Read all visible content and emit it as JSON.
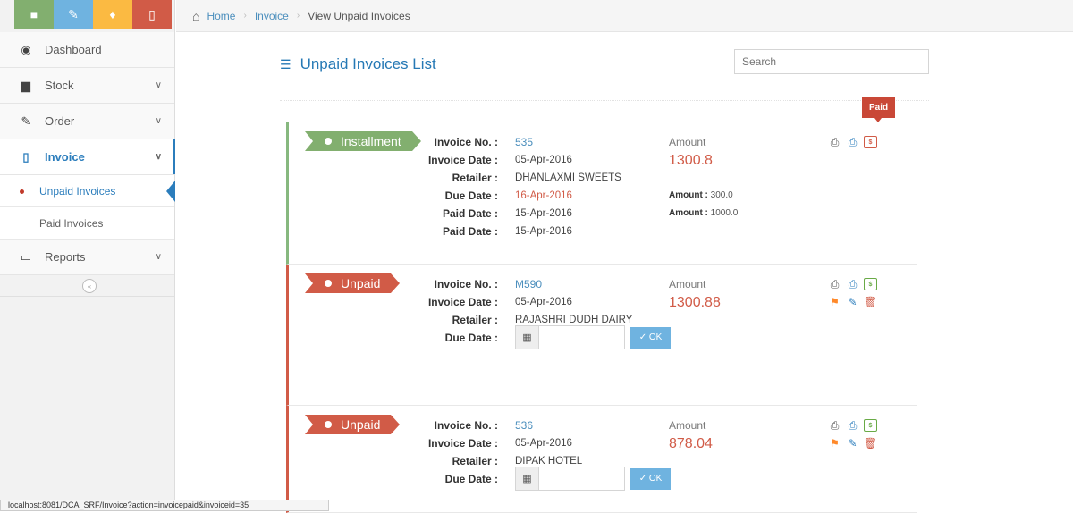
{
  "sidebar": {
    "shortcut_colors": [
      "#82af6f",
      "#6fb3e0",
      "#fbba42",
      "#d15b47"
    ],
    "items": [
      {
        "label": "Dashboard",
        "icon": "dashboard-icon"
      },
      {
        "label": "Stock",
        "icon": "briefcase-icon"
      },
      {
        "label": "Order",
        "icon": "edit-icon"
      },
      {
        "label": "Invoice",
        "icon": "file-icon"
      },
      {
        "label": "Reports",
        "icon": "desktop-icon"
      }
    ],
    "submenu": [
      {
        "label": "Unpaid Invoices"
      },
      {
        "label": "Paid Invoices"
      }
    ]
  },
  "breadcrumb": {
    "home": "Home",
    "invoice": "Invoice",
    "current": "View Unpaid Invoices"
  },
  "page": {
    "title": "Unpaid Invoices List",
    "search_placeholder": "Search"
  },
  "field_labels": {
    "invoice_no": "Invoice No. :",
    "invoice_date": "Invoice Date :",
    "retailer": "Retailer :",
    "due_date": "Due Date :",
    "paid_date": "Paid Date :",
    "amount": "Amount",
    "installment_amount": "Amount :"
  },
  "tooltip": "Paid",
  "ok_label": "OK",
  "invoices": [
    {
      "status": "Installment",
      "invoice_no": "535",
      "invoice_date": "05-Apr-2016",
      "retailer": "DHANLAXMI SWEETS",
      "due_date": "16-Apr-2016",
      "paid_dates": [
        "15-Apr-2016",
        "15-Apr-2016"
      ],
      "amount": "1300.8",
      "installments": [
        "300.0",
        "1000.0"
      ]
    },
    {
      "status": "Unpaid",
      "invoice_no": "M590",
      "invoice_date": "05-Apr-2016",
      "retailer": "RAJASHRI DUDH DAIRY",
      "amount": "1300.88"
    },
    {
      "status": "Unpaid",
      "invoice_no": "536",
      "invoice_date": "05-Apr-2016",
      "retailer": "DIPAK HOTEL",
      "amount": "878.04"
    }
  ],
  "status_bar": "localhost:8081/DCA_SRF/Invoice?action=invoicepaid&invoiceid=35"
}
